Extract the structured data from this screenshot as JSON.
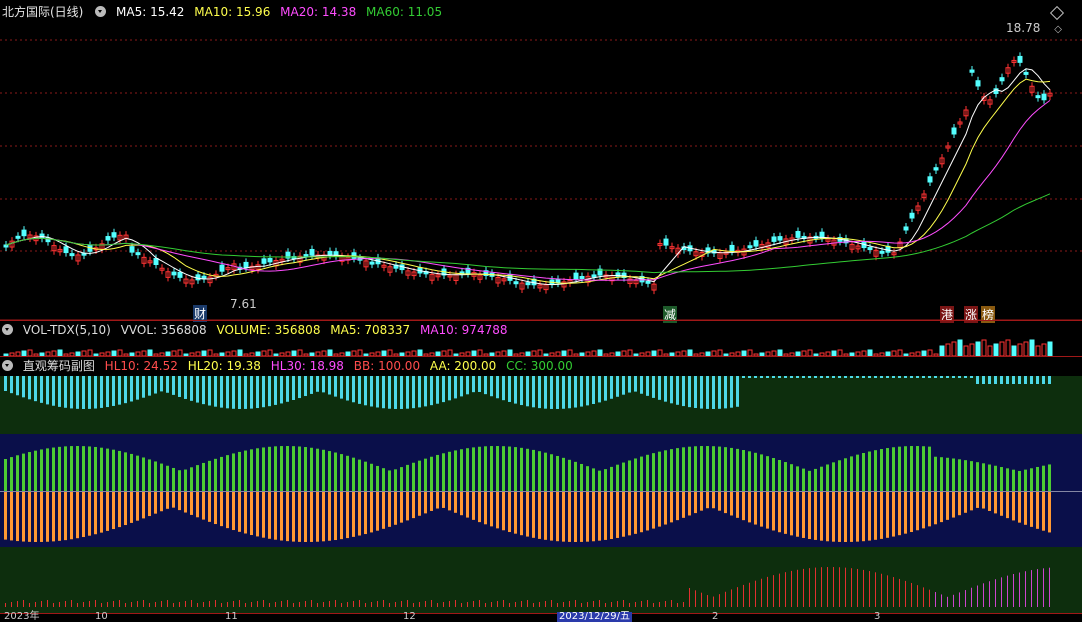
{
  "header": {
    "stock": "北方国际(日线)",
    "ma5": "MA5: 15.42",
    "ma10": "MA10: 15.96",
    "ma20": "MA20: 14.38",
    "ma60": "MA60: 11.05"
  },
  "price_labels": {
    "high": "18.78",
    "low": "7.61"
  },
  "event_tags": {
    "cai": "财",
    "jian": "减",
    "gang": "港",
    "zhang": "涨",
    "bang": "榜"
  },
  "vol_header": {
    "name": "VOL-TDX(5,10)",
    "vvol": "VVOL: 356808",
    "volume": "VOLUME: 356808",
    "ma5": "MA5: 708337",
    "ma10": "MA10: 974788"
  },
  "chip_header": {
    "name": "直观筹码副图",
    "hl10": "HL10: 24.52",
    "hl20": "HL20: 19.38",
    "hl30": "HL30: 18.98",
    "bb": "BB: 100.00",
    "aa": "AA: 200.00",
    "cc": "CC: 300.00"
  },
  "date_axis": {
    "d1": "2023年",
    "d2": "10",
    "d3": "11",
    "d4": "12",
    "d5": "2023/12/29/五",
    "d6": "2",
    "d7": "3"
  },
  "colors": {
    "ma5": "#ffffff",
    "ma10": "#ffff4d",
    "ma20": "#ff4dff",
    "ma60": "#33cc33",
    "up": "#ff3333",
    "down": "#54ffff",
    "grid": "#8a1a1a"
  }
}
